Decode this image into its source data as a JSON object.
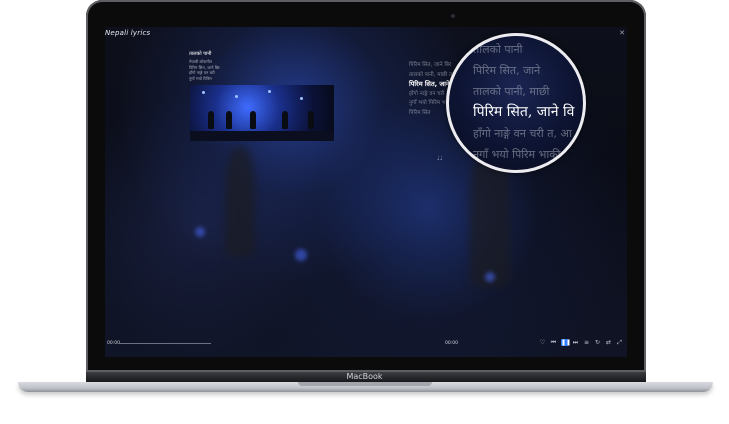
{
  "device": {
    "brand": "MacBook"
  },
  "app": {
    "logo_text": "Nepali lyrics",
    "close_icon": "close-icon"
  },
  "left_panel": {
    "title": "तालको पानी",
    "lines": [
      "नेपाली लोकगीत",
      "पिरिम सित, जाने बिर",
      "हाँगो नाङ्गे वन चरी",
      "नुगाँ भयो पिरिम"
    ]
  },
  "right_lyrics": {
    "lines": [
      "पिरिम सित, जाने बिर",
      "तालको पानी, माछी ता",
      "पिरिम सित, जाने बि",
      "हाँगो नाङ्गे वन चरी त, आ",
      "नुगाँ भयो पिरिम भाकी",
      "पिरिम सित"
    ],
    "active_index": 2,
    "note_icon": "music-note-icon"
  },
  "magnifier": {
    "lines": [
      "तालको पानी",
      "पिरिम सित, जाने",
      "तालको पानी, माछी",
      "पिरिम सित, जाने वि",
      "हाँगो नाङ्गे वन चरी त, आ",
      "नुगाँ भयो पिरिम भाकी",
      "पिरिम सित"
    ],
    "active_index": 3
  },
  "player": {
    "time_elapsed": "00:00",
    "time_total": "00:00",
    "progress_fraction": 0.0,
    "controls": [
      "heart-icon",
      "prev-icon",
      "pause-icon",
      "next-icon",
      "list-icon",
      "repeat-icon",
      "shuffle-icon",
      "fullscreen-icon"
    ]
  },
  "colors": {
    "accent": "#2f7cff"
  }
}
